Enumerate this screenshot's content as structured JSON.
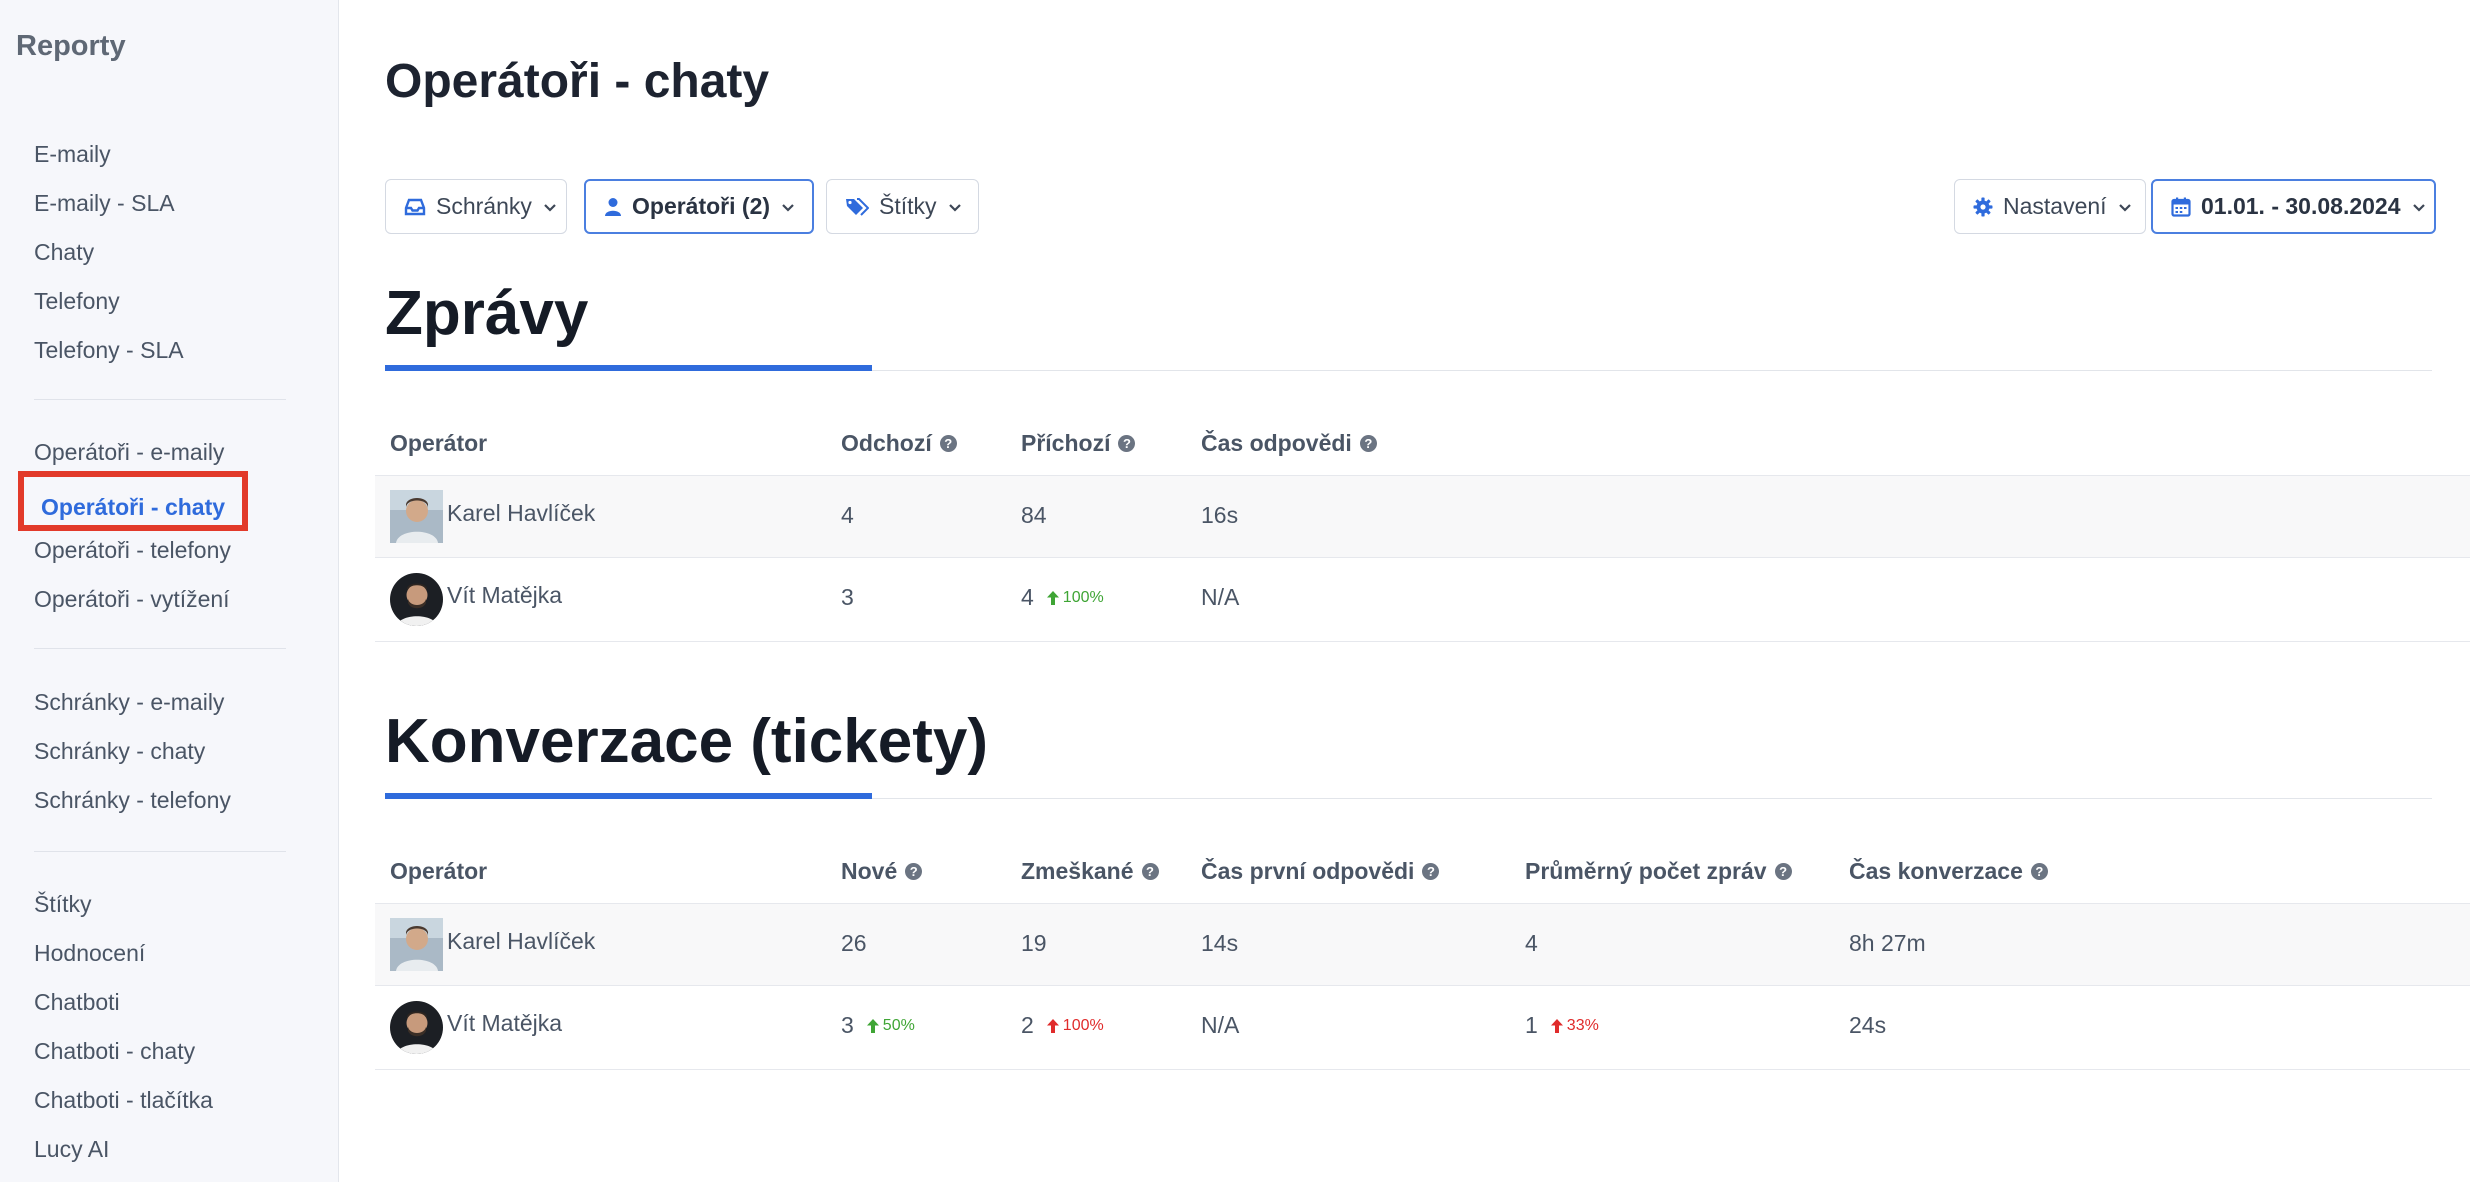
{
  "sidebar": {
    "title": "Reporty",
    "groups": [
      [
        "E-maily",
        "E-maily - SLA",
        "Chaty",
        "Telefony",
        "Telefony - SLA"
      ],
      [
        "Operátoři - e-maily",
        "Operátoři - chaty",
        "Operátoři - telefony",
        "Operátoři - vytížení"
      ],
      [
        "Schránky - e-maily",
        "Schránky - chaty",
        "Schránky - telefony"
      ],
      [
        "Štítky",
        "Hodnocení",
        "Chatboti",
        "Chatboti - chaty",
        "Chatboti - tlačítka",
        "Lucy AI"
      ]
    ],
    "active": "Operátoři - chaty"
  },
  "page": {
    "title": "Operátoři - chaty"
  },
  "filters": {
    "inboxes": "Schránky",
    "operators": "Operátoři (2)",
    "tags": "Štítky",
    "settings": "Nastavení",
    "date_range": "01.01. - 30.08.2024"
  },
  "messages": {
    "title": "Zprávy",
    "headers": {
      "operator": "Operátor",
      "outgoing": "Odchozí",
      "incoming": "Příchozí",
      "response_time": "Čas odpovědi"
    },
    "rows": [
      {
        "name": "Karel Havlíček",
        "outgoing": "4",
        "incoming": "84",
        "incoming_delta": "",
        "response_time": "16s"
      },
      {
        "name": "Vít Matějka",
        "outgoing": "3",
        "incoming": "4",
        "incoming_delta": "100%",
        "response_time": "N/A"
      }
    ]
  },
  "conversations": {
    "title": "Konverzace (tickety)",
    "headers": {
      "operator": "Operátor",
      "new": "Nové",
      "missed": "Zmeškané",
      "first_response": "Čas první odpovědi",
      "avg_messages": "Průměrný počet zpráv",
      "duration": "Čas konverzace"
    },
    "rows": [
      {
        "name": "Karel Havlíček",
        "new": "26",
        "new_delta": "",
        "missed": "19",
        "missed_delta": "",
        "first_response": "14s",
        "avg_messages": "4",
        "avg_delta": "",
        "duration": "8h 27m"
      },
      {
        "name": "Vít Matějka",
        "new": "3",
        "new_delta": "50%",
        "missed": "2",
        "missed_delta": "100%",
        "first_response": "N/A",
        "avg_messages": "1",
        "avg_delta": "33%",
        "duration": "24s"
      }
    ]
  },
  "colors": {
    "accent": "#2f6bdc",
    "positive": "#3fa535",
    "negative": "#e02b2b",
    "highlight_box": "#e23a2a"
  }
}
